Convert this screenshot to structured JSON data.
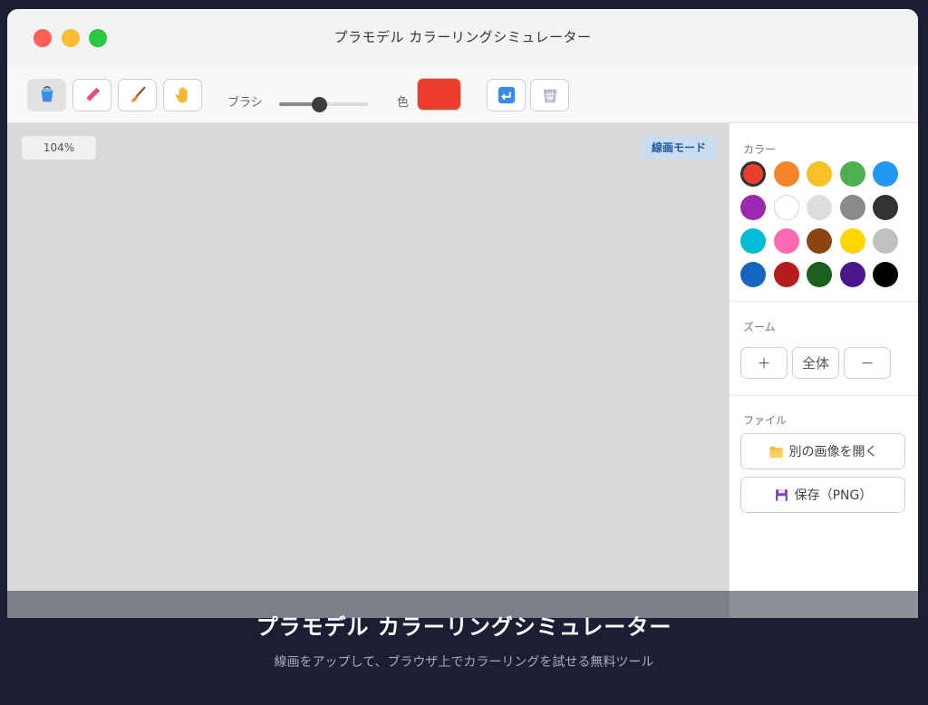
{
  "window": {
    "title": "プラモデル カラーリングシミュレーター"
  },
  "toolbar": {
    "tools": [
      {
        "name": "bucket-icon",
        "active": true
      },
      {
        "name": "pen-icon",
        "active": false
      },
      {
        "name": "brush-icon",
        "active": false
      },
      {
        "name": "hand-icon",
        "active": false
      }
    ],
    "brush_label": "ブラシ",
    "brush_size": 0.45,
    "color_label": "色",
    "current_color": "#ea3d2e",
    "undo_icon": "undo-icon",
    "clear_icon": "trash-icon"
  },
  "canvas": {
    "zoom": "104%",
    "mode": "線画モード",
    "background": "#d9d9d9"
  },
  "panel": {
    "color_title": "カラー",
    "palette": [
      "#ea3d2e",
      "#f5832a",
      "#f5c325",
      "#4caf50",
      "#2196f3",
      "#9c27b0",
      "#ffffff",
      "#dddddd",
      "#8a8a8a",
      "#333333",
      "#00bcd4",
      "#ff69b4",
      "#8b4513",
      "#ffd700",
      "#c0c0c0",
      "#1565c0",
      "#b71c1c",
      "#1b5e20",
      "#4a148c",
      "#000000"
    ],
    "zoom_title": "ズーム",
    "zoom_in": "＋",
    "zoom_fit": "全体",
    "zoom_out": "－",
    "file_title": "ファイル",
    "open_image": "別の画像を開く",
    "save_png": "保存（PNG）"
  },
  "hero": {
    "title": "プラモデル カラーリングシミュレーター",
    "subtitle": "線画をアップして、ブラウザ上でカラーリングを試せる無料ツール"
  }
}
